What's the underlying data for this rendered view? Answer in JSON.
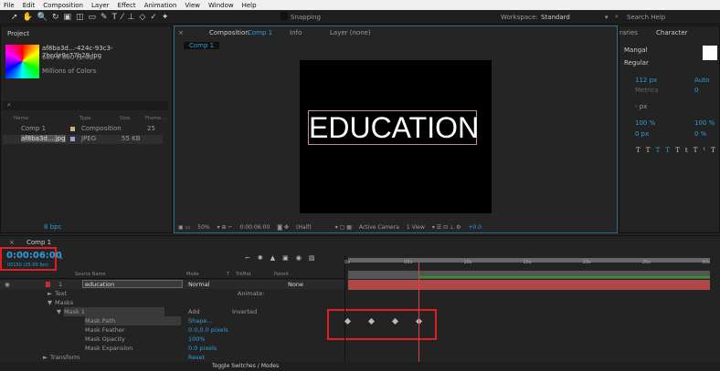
{
  "menu": [
    "File",
    "Edit",
    "Composition",
    "Layer",
    "Effect",
    "Animation",
    "View",
    "Window",
    "Help"
  ],
  "toolbar": {
    "snapping": "Snapping",
    "workspace_label": "Workspace:",
    "workspace": "Standard",
    "search": "Search Help"
  },
  "project": {
    "title": "Project",
    "file": "af8ba3d...-424c-93c3-7bcde9c77b29.jpg",
    "dims": "600 x 600 (1.00)",
    "colors": "Millions of Colors",
    "columns": [
      "Name",
      "Type",
      "Size",
      "Frame ..."
    ],
    "items": [
      {
        "name": "Comp 1",
        "type": "Composition",
        "size": "",
        "frame": "25"
      },
      {
        "name": "af8ba3d....jpg",
        "type": "JPEG",
        "size": "55 KB",
        "frame": ""
      }
    ],
    "bpc": "8 bpc"
  },
  "viewer": {
    "tab_prefix": "Composition",
    "tab_comp": "Comp 1",
    "info": "Info",
    "layer": "Layer (none)",
    "breadcrumb": "Comp 1",
    "text": "EDUCATION",
    "zoom": "50%",
    "time": "0:00:06:00",
    "res": "(Half)",
    "camera": "Active Camera",
    "views": "1 View",
    "exposure": "+0.0"
  },
  "character": {
    "tab_left": "raries",
    "title": "Character",
    "font": "Mangal",
    "style": "Regular",
    "size": "112 px",
    "leading": "Auto",
    "kerning": "Metrics",
    "tracking": "0",
    "stroke": "- px",
    "vscale": "100 %",
    "hscale": "100 %",
    "baseline": "0 px",
    "tsume": "0 %"
  },
  "timeline": {
    "tab": "Comp 1",
    "timecode": "0:00:06:00",
    "frames": "00150 (25.00 fps)",
    "columns": {
      "source": "Source Name",
      "mode": "Mode",
      "t": "T",
      "trkmat": "TrkMat",
      "parent": "Parent"
    },
    "layer": {
      "num": "1",
      "name": "education",
      "mode": "Normal",
      "parent": "None"
    },
    "rows": [
      {
        "label": "Text",
        "value": "Animate:"
      },
      {
        "label": "Masks",
        "value": ""
      },
      {
        "label": "Mask 1",
        "value": "Add",
        "extra": "Inverted"
      },
      {
        "label": "Mask Path",
        "value": "Shape..."
      },
      {
        "label": "Mask Feather",
        "value": "0.0,0.0 pixels"
      },
      {
        "label": "Mask Opacity",
        "value": "100%"
      },
      {
        "label": "Mask Expansion",
        "value": "0.0 pixels"
      },
      {
        "label": "Transform",
        "value": "Reset"
      }
    ],
    "ruler": [
      "0s",
      "05s",
      "10s",
      "15s",
      "20s",
      "25s",
      "30s"
    ],
    "playhead_seconds": 6,
    "duration_seconds": 30,
    "keyframes_seconds": [
      0,
      2,
      4,
      6
    ],
    "toggle": "Toggle Switches / Modes"
  },
  "colors": {
    "accent": "#2d9cdb",
    "highlight": "#e02020",
    "layer_bar": "#b04848"
  }
}
